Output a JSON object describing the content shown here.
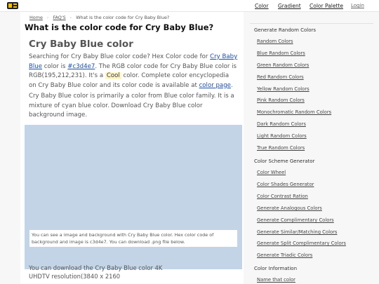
{
  "topnav": {
    "logo": "colorcode-logo-icon",
    "items": [
      "Color",
      "Gradient",
      "Color Palette",
      "Login"
    ]
  },
  "breadcrumb": {
    "home": "Home",
    "faqs": "FAQ'S",
    "current": "What is the color code for Cry Baby Blue?"
  },
  "main": {
    "page_title": "What is the color code for Cry Baby Blue?",
    "color_title": "Cry Baby Blue color",
    "para1": {
      "t1": "Searching for Cry Baby Blue color code? Hex Color code for ",
      "link1": "Cry Baby Blue",
      "t2": " color is ",
      "hex_link": "#c3d4e7",
      "t3": ". The RGB color code for Cry Baby Blue color is RGB(195,212,231). It's a ",
      "cool": "Cool",
      "t4": " color. Complete color encyclopedia on Cry Baby Blue color and its color code is available at ",
      "page_link": "color page",
      "t5": "."
    },
    "para2": "Cry Baby Blue color is primarily a color from Blue color family. It is a mixture of cyan blue color. Download Cry Baby Blue color background image.",
    "swatch_color": "#c3d4e7",
    "swatch_note": "You can see a image and background with Cry Baby Blue color. Hex color code of background and image is c3d4e7. You can download .png file below.",
    "download_para": "You can download the Cry Baby Blue color 4K UHDTV resolution(3840 x 2160"
  },
  "sidebar": {
    "sections": [
      {
        "heading": "Generate Random Colors",
        "links": [
          "Random Colors",
          "Blue Random Colors",
          "Green Random Colors",
          "Red Random Colors",
          "Yellow Random Colors",
          "Pink Random Colors",
          "Monochromatic Random Colors",
          "Dark Random Colors",
          "Light Random Colors",
          "True Random Colors"
        ]
      },
      {
        "heading": "Color Scheme Generator",
        "links": [
          "Color Wheel",
          "Color Shades Generator",
          "Color Contrast Ration",
          "Generate Analogous Colors",
          "Generate Complimentary Colors",
          "Generate Similar/Matching Colors",
          "Generate Split Complimentary Colors",
          "Generate Triadic Colors"
        ]
      },
      {
        "heading": "Color Information",
        "links": [
          "Name that color"
        ]
      }
    ]
  }
}
